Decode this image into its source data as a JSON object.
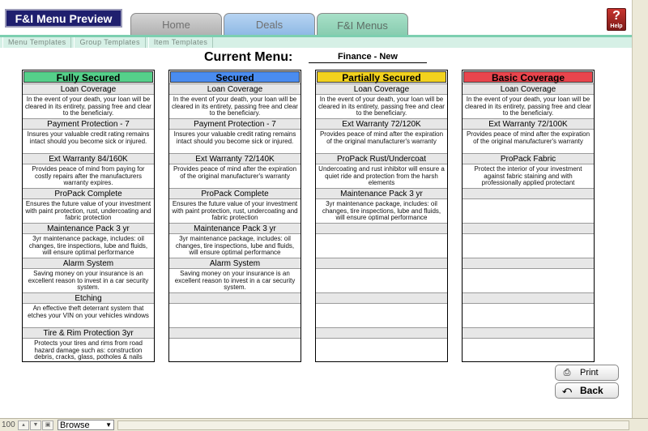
{
  "app": {
    "title": "F&I Menu Preview"
  },
  "tabs": [
    {
      "label": "Home"
    },
    {
      "label": "Deals"
    },
    {
      "label": "F&I Menus"
    }
  ],
  "subtabs": [
    "Menu Templates",
    "Group Templates",
    "Item Templates"
  ],
  "help": {
    "symbol": "?",
    "label": "Help"
  },
  "current_menu": {
    "label": "Current Menu:",
    "value": "Finance - New"
  },
  "columns": [
    {
      "name": "Fully Secured",
      "color": "#55d08a",
      "items": [
        {
          "title": "Loan Coverage",
          "desc": "In the event of your death, your loan will be cleared in its entirety, passing free and clear to the beneficiary."
        },
        {
          "title": "Payment Protection - 7",
          "desc": "Insures your valuable credit rating remains intact should you become sick or injured."
        },
        {
          "title": "Ext Warranty 84/160K",
          "desc": "Provides peace of mind from paying for costly repairs after the manufacturers warranty expires."
        },
        {
          "title": "ProPack Complete",
          "desc": "Ensures the future value of your investment with paint protection, rust, undercoating and fabric protection"
        },
        {
          "title": "Maintenance Pack 3 yr",
          "desc": "3yr maintenance package, includes: oil changes, tire inspections, lube and fluids, will ensure optimal performance"
        },
        {
          "title": "Alarm System",
          "desc": "Saving money on your insurance is an excellent reason to invest in a car security system."
        },
        {
          "title": "Etching",
          "desc": "An effective theft deterrant system that etches your VIN on your vehicles windows"
        },
        {
          "title": "Tire & Rim Protection 3yr",
          "desc": "Protects your tires and rims from road hazard damage such as: construction debris, cracks, glass, potholes & nails"
        }
      ]
    },
    {
      "name": "Secured",
      "color": "#4a8cf0",
      "items": [
        {
          "title": "Loan Coverage",
          "desc": "In the event of your death, your loan will be cleared in its entirety, passing free and clear to the beneficiary."
        },
        {
          "title": "Payment Protection - 7",
          "desc": "Insures your valuable credit rating remains intact should you become sick or injured."
        },
        {
          "title": "Ext Warranty 72/140K",
          "desc": "Provides peace of mind after the expiration of the original manufacturer's warranty"
        },
        {
          "title": "ProPack Complete",
          "desc": "Ensures the future value of your investment with paint protection, rust, undercoating and fabric protection"
        },
        {
          "title": "Maintenance Pack 3 yr",
          "desc": "3yr maintenance package, includes: oil changes, tire inspections, lube and fluids, will ensure optimal performance"
        },
        {
          "title": "Alarm System",
          "desc": "Saving money on your insurance is an excellent reason to invest in a car security system."
        }
      ]
    },
    {
      "name": "Partially Secured",
      "color": "#f2d21e",
      "items": [
        {
          "title": "Loan Coverage",
          "desc": "In the event of your death, your loan will be cleared in its entirety, passing free and clear to the beneficiary."
        },
        {
          "title": "Ext Warranty 72/120K",
          "desc": "Provides peace of mind after the expiration of the original manufacturer's warranty"
        },
        {
          "title": "ProPack Rust/Undercoat",
          "desc": "Undercoating and rust inhibitor will ensure a quiet ride and protection from the harsh elements"
        },
        {
          "title": "Maintenance Pack 3 yr",
          "desc": "3yr maintenance package, includes: oil changes, tire inspections, lube and fluids, will ensure optimal performance"
        }
      ]
    },
    {
      "name": "Basic Coverage",
      "color": "#e8454d",
      "items": [
        {
          "title": "Loan Coverage",
          "desc": "In the event of your death, your loan will be cleared in its entirety, passing free and clear to the beneficiary."
        },
        {
          "title": "Ext Warranty 72/100K",
          "desc": "Provides peace of mind after the expiration of the original manufacturer's warranty"
        },
        {
          "title": "ProPack Fabric",
          "desc": "Protect the interior of your investment against fabric staining and with professionally applied protectant"
        }
      ]
    }
  ],
  "buttons": {
    "print": "Print",
    "back": "Back"
  },
  "status": {
    "zoom": "100",
    "mode": "Browse"
  }
}
